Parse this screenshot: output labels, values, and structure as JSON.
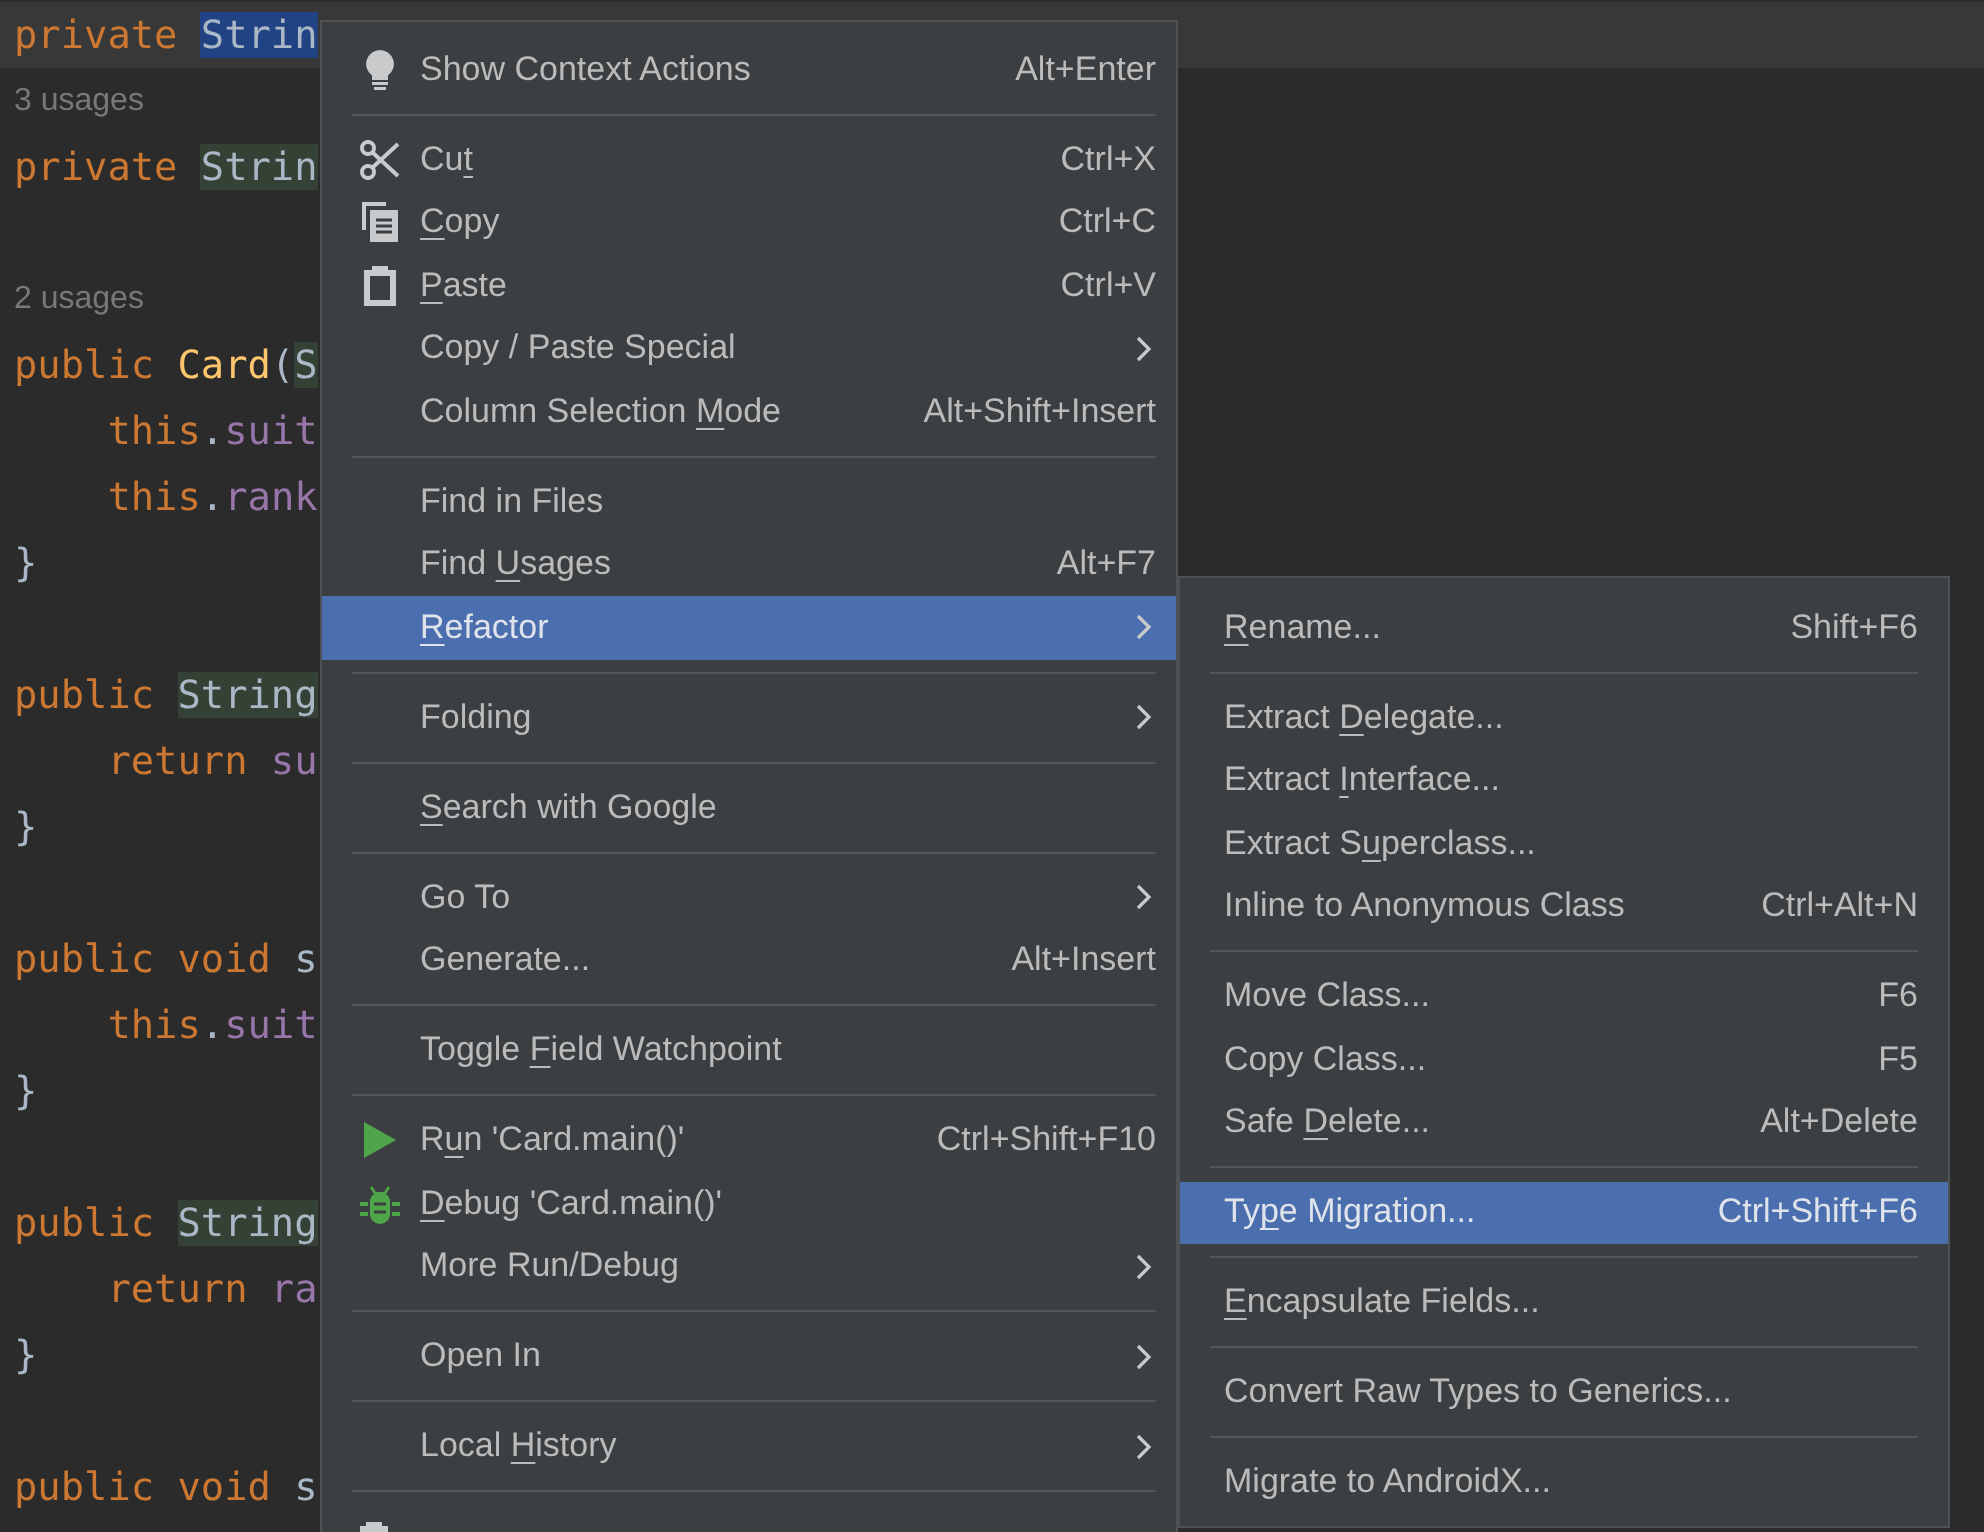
{
  "editor": {
    "lines": [
      {
        "kind": "code",
        "current": true,
        "tokens": [
          {
            "text": "private ",
            "kind": "keyword"
          },
          {
            "text": "Strin",
            "kind": "selection"
          }
        ]
      },
      {
        "kind": "hint",
        "text": "3 usages"
      },
      {
        "kind": "code",
        "current": false,
        "tokens": [
          {
            "text": "private ",
            "kind": "keyword"
          },
          {
            "text": "Strin",
            "kind": "usage"
          }
        ]
      },
      {
        "kind": "blank"
      },
      {
        "kind": "hint",
        "text": "2 usages"
      },
      {
        "kind": "code",
        "current": false,
        "tokens": [
          {
            "text": "public ",
            "kind": "keyword"
          },
          {
            "text": "Card",
            "kind": "method"
          },
          {
            "text": "(",
            "kind": "plain"
          },
          {
            "text": "S",
            "kind": "usage"
          }
        ]
      },
      {
        "kind": "code",
        "current": false,
        "tokens": [
          {
            "text": "    this",
            "kind": "keyword"
          },
          {
            "text": ".",
            "kind": "plain"
          },
          {
            "text": "suit",
            "kind": "field"
          }
        ]
      },
      {
        "kind": "code",
        "current": false,
        "tokens": [
          {
            "text": "    this",
            "kind": "keyword"
          },
          {
            "text": ".",
            "kind": "plain"
          },
          {
            "text": "rank",
            "kind": "field"
          }
        ]
      },
      {
        "kind": "code",
        "current": false,
        "tokens": [
          {
            "text": "}",
            "kind": "plain"
          }
        ]
      },
      {
        "kind": "blank"
      },
      {
        "kind": "code",
        "current": false,
        "tokens": [
          {
            "text": "public ",
            "kind": "keyword"
          },
          {
            "text": "String",
            "kind": "usage"
          }
        ]
      },
      {
        "kind": "code",
        "current": false,
        "tokens": [
          {
            "text": "    return ",
            "kind": "keyword"
          },
          {
            "text": "su",
            "kind": "field"
          }
        ]
      },
      {
        "kind": "code",
        "current": false,
        "tokens": [
          {
            "text": "}",
            "kind": "plain"
          }
        ]
      },
      {
        "kind": "blank"
      },
      {
        "kind": "code",
        "current": false,
        "tokens": [
          {
            "text": "public void ",
            "kind": "keyword"
          },
          {
            "text": "s",
            "kind": "plain"
          }
        ]
      },
      {
        "kind": "code",
        "current": false,
        "tokens": [
          {
            "text": "    this",
            "kind": "keyword"
          },
          {
            "text": ".",
            "kind": "plain"
          },
          {
            "text": "suit",
            "kind": "field"
          }
        ]
      },
      {
        "kind": "code",
        "current": false,
        "tokens": [
          {
            "text": "}",
            "kind": "plain"
          }
        ]
      },
      {
        "kind": "blank"
      },
      {
        "kind": "code",
        "current": false,
        "tokens": [
          {
            "text": "public ",
            "kind": "keyword"
          },
          {
            "text": "String",
            "kind": "usage"
          }
        ]
      },
      {
        "kind": "code",
        "current": false,
        "tokens": [
          {
            "text": "    return ",
            "kind": "keyword"
          },
          {
            "text": "ra",
            "kind": "field"
          }
        ]
      },
      {
        "kind": "code",
        "current": false,
        "tokens": [
          {
            "text": "}",
            "kind": "plain"
          }
        ]
      },
      {
        "kind": "blank"
      },
      {
        "kind": "code",
        "current": false,
        "tokens": [
          {
            "text": "public void ",
            "kind": "keyword"
          },
          {
            "text": "s",
            "kind": "plain"
          }
        ]
      }
    ]
  },
  "context_menu": {
    "groups": [
      [
        {
          "label": "Show Context Actions",
          "shortcut": "Alt+Enter",
          "submenu": false,
          "selected": false
        }
      ],
      [
        {
          "mnemonic": {
            "before": "Cu",
            "key": "t"
          },
          "shortcut": "Ctrl+X",
          "submenu": false,
          "selected": false
        },
        {
          "mnemonic": {
            "key": "C",
            "after": "opy"
          },
          "shortcut": "Ctrl+C",
          "submenu": false,
          "selected": false
        },
        {
          "mnemonic": {
            "key": "P",
            "after": "aste"
          },
          "shortcut": "Ctrl+V",
          "submenu": false,
          "selected": false
        },
        {
          "label": "Copy / Paste Special",
          "submenu": true,
          "selected": false
        },
        {
          "mnemonic": {
            "before": "Column Selection ",
            "key": "M",
            "after": "ode"
          },
          "shortcut": "Alt+Shift+Insert",
          "submenu": false,
          "selected": false
        }
      ],
      [
        {
          "label": "Find in Files",
          "submenu": false,
          "selected": false
        },
        {
          "mnemonic": {
            "before": "Find ",
            "key": "U",
            "after": "sages"
          },
          "shortcut": "Alt+F7",
          "submenu": false,
          "selected": false
        },
        {
          "mnemonic": {
            "key": "R",
            "after": "efactor"
          },
          "submenu": true,
          "selected": true
        }
      ],
      [
        {
          "label": "Folding",
          "submenu": true,
          "selected": false
        }
      ],
      [
        {
          "mnemonic": {
            "key": "S",
            "after": "earch with Google"
          },
          "submenu": false,
          "selected": false
        }
      ],
      [
        {
          "label": "Go To",
          "submenu": true,
          "selected": false
        },
        {
          "label": "Generate...",
          "shortcut": "Alt+Insert",
          "submenu": false,
          "selected": false
        }
      ],
      [
        {
          "mnemonic": {
            "before": "Toggle ",
            "key": "F",
            "after": "ield Watchpoint"
          },
          "submenu": false,
          "selected": false
        }
      ],
      [
        {
          "mnemonic": {
            "before": "R",
            "key": "u",
            "after": "n 'Card.main()'"
          },
          "shortcut": "Ctrl+Shift+F10",
          "submenu": false,
          "selected": false
        },
        {
          "mnemonic": {
            "key": "D",
            "after": "ebug 'Card.main()'"
          },
          "submenu": false,
          "selected": false
        },
        {
          "label": "More Run/Debug",
          "submenu": true,
          "selected": false
        }
      ],
      [
        {
          "label": "Open In",
          "submenu": true,
          "selected": false
        }
      ],
      [
        {
          "mnemonic": {
            "before": "Local ",
            "key": "H",
            "after": "istory"
          },
          "submenu": true,
          "selected": false
        }
      ]
    ]
  },
  "refactor_submenu": {
    "groups": [
      [
        {
          "mnemonic": {
            "key": "R",
            "after": "ename..."
          },
          "shortcut": "Shift+F6",
          "selected": false
        }
      ],
      [
        {
          "mnemonic": {
            "before": "Extract ",
            "key": "D",
            "after": "elegate..."
          },
          "selected": false
        },
        {
          "mnemonic": {
            "before": "Extract ",
            "key": "I",
            "after": "nterface..."
          },
          "selected": false
        },
        {
          "mnemonic": {
            "before": "Extract S",
            "key": "u",
            "after": "perclass..."
          },
          "selected": false
        },
        {
          "label": "Inline to Anonymous Class",
          "shortcut": "Ctrl+Alt+N",
          "selected": false
        }
      ],
      [
        {
          "label": "Move Class...",
          "shortcut": "F6",
          "selected": false
        },
        {
          "label": "Copy Class...",
          "shortcut": "F5",
          "selected": false
        },
        {
          "mnemonic": {
            "before": "Safe ",
            "key": "D",
            "after": "elete..."
          },
          "shortcut": "Alt+Delete",
          "selected": false
        }
      ],
      [
        {
          "mnemonic": {
            "before": "Ty",
            "key": "p",
            "after": "e Migration..."
          },
          "shortcut": "Ctrl+Shift+F6",
          "selected": true
        }
      ],
      [
        {
          "mnemonic": {
            "key": "E",
            "after": "ncapsulate Fields..."
          },
          "selected": false
        }
      ],
      [
        {
          "label": "Convert Raw Types to Generics...",
          "selected": false
        }
      ],
      [
        {
          "label": "Migrate to AndroidX...",
          "selected": false
        }
      ]
    ]
  }
}
